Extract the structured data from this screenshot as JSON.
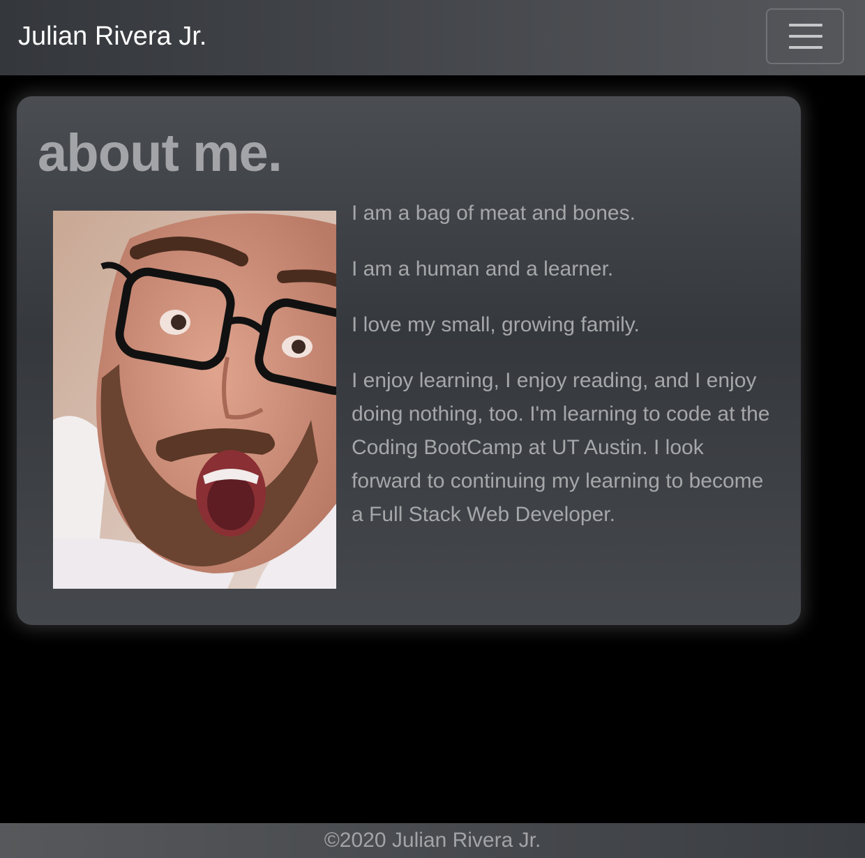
{
  "navbar": {
    "brand": "Julian Rivera Jr.",
    "toggler_icon": "hamburger-menu-icon"
  },
  "about": {
    "title": "about me.",
    "photo_icon": "profile-photo",
    "paragraphs": [
      "I am a bag of meat and bones.",
      "I am a human and a learner.",
      "I love my small, growing family.",
      "I enjoy learning, I enjoy reading, and I enjoy doing nothing, too. I'm learning to code at the Coding BootCamp at UT Austin. I look forward to continuing my learning to become a Full Stack Web Developer."
    ]
  },
  "footer": {
    "text": "©2020 Julian Rivera Jr."
  },
  "colors": {
    "page_background": "#000000",
    "navbar_gradient_start": "#34373c",
    "navbar_gradient_end": "#55575b",
    "card_background": "#3d4045",
    "title_text": "#a3a4a7",
    "body_text": "#a6a7a9",
    "brand_text": "#ffffff"
  }
}
